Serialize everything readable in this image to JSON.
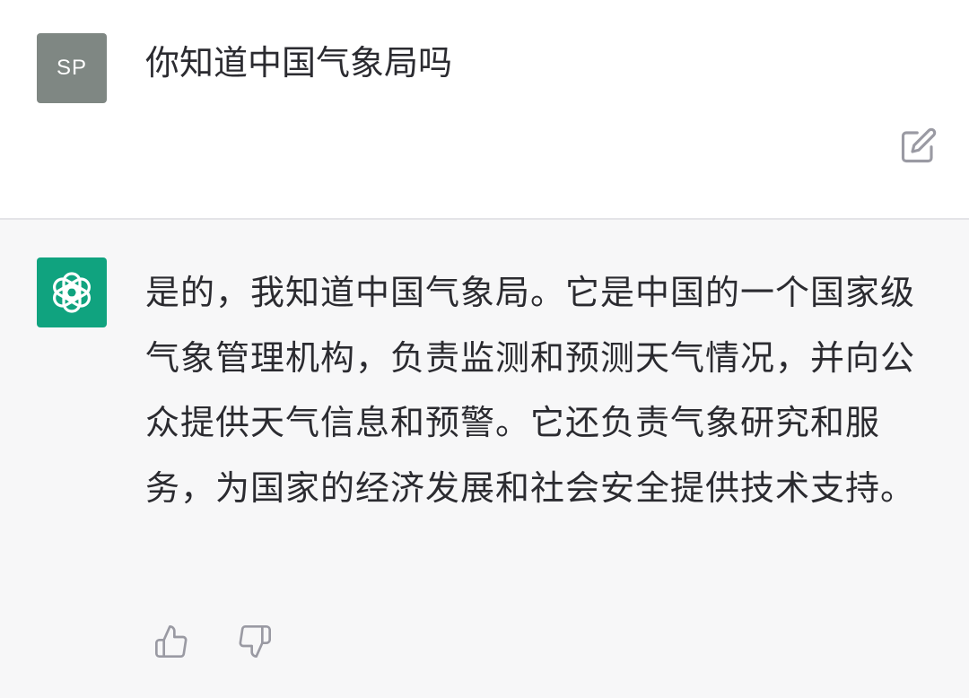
{
  "user_message": {
    "avatar_initials": "SP",
    "text": "你知道中国气象局吗",
    "edit_icon": "edit-icon"
  },
  "assistant_message": {
    "avatar_icon": "openai-logo-icon",
    "text": "是的，我知道中国气象局。它是中国的一个国家级气象管理机构，负责监测和预测天气情况，并向公众提供天气信息和预警。它还负责气象研究和服务，为国家的经济发展和社会安全提供技术支持。"
  },
  "feedback": {
    "like_icon": "thumbs-up-icon",
    "dislike_icon": "thumbs-down-icon"
  },
  "colors": {
    "user_bg": "#ffffff",
    "assistant_bg": "#f7f7f8",
    "user_avatar": "#7f8783",
    "brand_green": "#10a37f",
    "text": "#2b2b30",
    "icon": "#9a9aa3"
  }
}
